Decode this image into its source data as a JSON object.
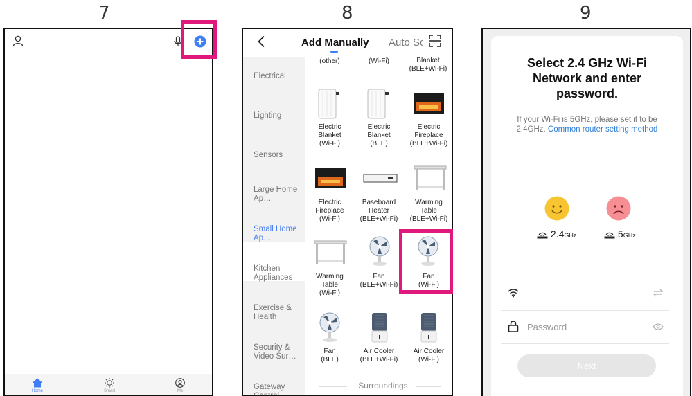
{
  "steps": {
    "s7": "7",
    "s8": "8",
    "s9": "9"
  },
  "screen7": {
    "tabs": [
      {
        "label": "Home",
        "icon": "home-icon"
      },
      {
        "label": "Smart",
        "icon": "sun-icon"
      },
      {
        "label": "Me",
        "icon": "user-circle-icon"
      }
    ]
  },
  "screen8": {
    "header": {
      "title": "Add Manually",
      "tab2": "Auto Sc"
    },
    "categories": [
      "Electrical",
      "Lighting",
      "Sensors",
      "Large Home Ap…",
      "Small Home Ap…",
      "Kitchen Appliances",
      "Exercise & Health",
      "Security & Video Sur…",
      "Gateway Control"
    ],
    "top_partial": [
      "(other)",
      "(Wi-Fi)",
      "Blanket (BLE+Wi-Fi)"
    ],
    "devices": [
      {
        "name": "Electric Blanket (Wi-Fi)",
        "lines": [
          "Electric",
          "Blanket",
          "(Wi-Fi)"
        ]
      },
      {
        "name": "Electric Blanket (BLE)",
        "lines": [
          "Electric",
          "Blanket",
          "(BLE)"
        ]
      },
      {
        "name": "Electric Fireplace (BLE+Wi-Fi)",
        "lines": [
          "Electric",
          "Fireplace",
          "(BLE+Wi-Fi)"
        ]
      },
      {
        "name": "Electric Fireplace (Wi-Fi)",
        "lines": [
          "Electric",
          "Fireplace",
          "(Wi-Fi)"
        ]
      },
      {
        "name": "Baseboard Heater (BLE+Wi-Fi)",
        "lines": [
          "Baseboard",
          "Heater",
          "(BLE+Wi-Fi)"
        ]
      },
      {
        "name": "Warming Table (BLE+Wi-Fi)",
        "lines": [
          "Warming",
          "Table",
          "(BLE+Wi-Fi)"
        ]
      },
      {
        "name": "Warming Table (Wi-Fi)",
        "lines": [
          "Warming",
          "Table",
          "(Wi-Fi)"
        ]
      },
      {
        "name": "Fan (BLE+Wi-Fi)",
        "lines": [
          "Fan",
          "(BLE+Wi-Fi)"
        ]
      },
      {
        "name": "Fan (Wi-Fi)",
        "lines": [
          "Fan",
          "(Wi-Fi)"
        ]
      },
      {
        "name": "Fan (BLE)",
        "lines": [
          "Fan",
          "(BLE)"
        ]
      },
      {
        "name": "Air Cooler (BLE+Wi-Fi)",
        "lines": [
          "Air Cooler",
          "(BLE+Wi-Fi)"
        ]
      },
      {
        "name": "Air Cooler (Wi-Fi)",
        "lines": [
          "Air Cooler",
          "(Wi-Fi)"
        ]
      }
    ],
    "section_footer": "Surroundings"
  },
  "screen9": {
    "title_lines": [
      "Select 2.4 GHz Wi-Fi",
      "Network and enter",
      "password."
    ],
    "hint": "If your Wi-Fi is 5GHz, please set it to be 2.4GHz.",
    "link_text": "Common router setting method",
    "band_24": "2.4",
    "band_24_unit": "GHz",
    "band_5": "5",
    "band_5_unit": "GHz",
    "password_placeholder": "Password",
    "next_label": "Next",
    "colors": {
      "happy": "#f7c531",
      "sad": "#f58f94",
      "link": "#2f7fd8",
      "next": "#e6e6e6"
    }
  }
}
